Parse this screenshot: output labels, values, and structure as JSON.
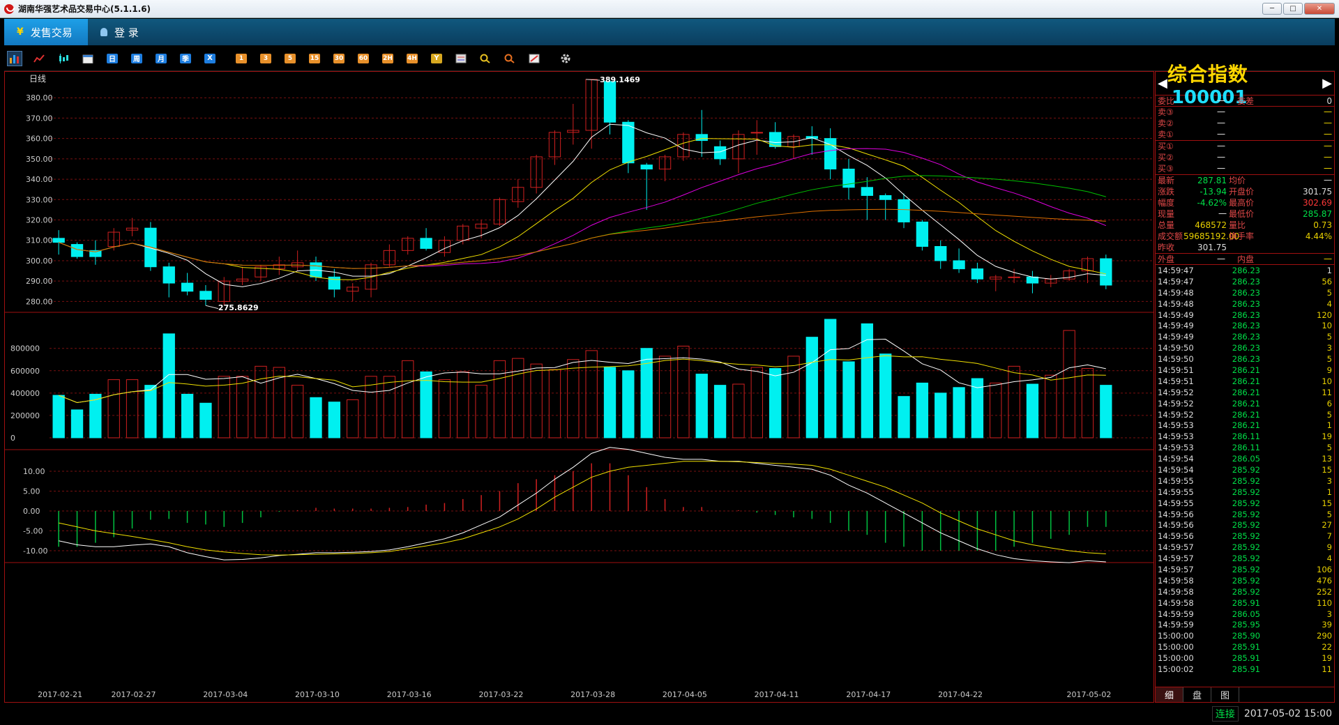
{
  "window": {
    "title": "湖南华强艺术品交易中心(5.1.1.6)",
    "controls": [
      "─",
      "□",
      "✕"
    ]
  },
  "nav": {
    "tabs": [
      {
        "label": "发售交易",
        "icon": "yen-icon",
        "active": true
      },
      {
        "label": "登 录",
        "icon": "user-icon",
        "active": false
      }
    ]
  },
  "toolbar": {
    "periods": [
      "日",
      "周",
      "月",
      "季",
      "X"
    ],
    "minutes": [
      "1",
      "3",
      "5",
      "15",
      "30",
      "60",
      "2H",
      "4H",
      "Y"
    ]
  },
  "chart": {
    "period_label": "日线",
    "price_axis": [
      "380.00",
      "370.00",
      "360.00",
      "350.00",
      "340.00",
      "330.00",
      "320.00",
      "310.00",
      "300.00",
      "290.00",
      "280.00"
    ],
    "volume_axis": [
      "800000",
      "600000",
      "400000",
      "200000",
      "0"
    ],
    "macd_axis": [
      "10.00",
      "5.00",
      "0.00",
      "-5.00",
      "-10.00"
    ],
    "high_label": "389.1469",
    "low_label": "275.8629",
    "dates": [
      "2017-02-21",
      "2017-02-27",
      "2017-03-04",
      "2017-03-10",
      "2017-03-16",
      "2017-03-22",
      "2017-03-28",
      "2017-04-05",
      "2017-04-11",
      "2017-04-17",
      "2017-04-22",
      "2017-05-02"
    ]
  },
  "chart_data": {
    "type": "candlestick",
    "candles": [
      [
        311,
        315,
        303,
        309
      ],
      [
        308,
        309,
        301,
        302
      ],
      [
        305,
        310,
        298,
        302
      ],
      [
        307,
        316,
        305,
        314
      ],
      [
        315,
        321,
        312,
        316
      ],
      [
        316,
        319,
        295,
        297
      ],
      [
        297,
        299,
        282,
        289
      ],
      [
        289,
        294,
        283,
        285
      ],
      [
        285,
        288,
        278,
        281
      ],
      [
        280,
        292,
        278,
        290
      ],
      [
        290,
        297,
        288,
        291
      ],
      [
        292,
        298,
        290,
        297
      ],
      [
        296,
        302,
        293,
        298
      ],
      [
        297,
        305,
        295,
        299
      ],
      [
        299,
        302,
        290,
        292
      ],
      [
        292,
        296,
        282,
        286
      ],
      [
        285,
        289,
        280,
        287
      ],
      [
        286,
        299,
        282,
        298
      ],
      [
        298,
        308,
        297,
        305
      ],
      [
        305,
        312,
        303,
        311
      ],
      [
        311,
        316,
        305,
        306
      ],
      [
        304,
        312,
        302,
        310
      ],
      [
        310,
        318,
        308,
        317
      ],
      [
        316,
        320,
        311,
        318
      ],
      [
        318,
        331,
        317,
        330
      ],
      [
        329,
        340,
        326,
        336
      ],
      [
        336,
        352,
        333,
        351
      ],
      [
        351,
        364,
        347,
        363
      ],
      [
        363,
        377,
        357,
        364
      ],
      [
        364,
        389,
        355,
        389
      ],
      [
        388,
        389,
        362,
        368
      ],
      [
        368,
        369,
        343,
        348
      ],
      [
        347,
        348,
        325,
        345
      ],
      [
        345,
        352,
        339,
        351
      ],
      [
        351,
        363,
        349,
        362
      ],
      [
        362,
        374,
        351,
        359
      ],
      [
        356,
        359,
        347,
        350
      ],
      [
        350,
        364,
        343,
        362
      ],
      [
        363,
        369,
        352,
        363
      ],
      [
        363,
        368,
        355,
        356
      ],
      [
        356,
        362,
        350,
        361
      ],
      [
        361,
        366,
        352,
        360
      ],
      [
        360,
        365,
        340,
        345
      ],
      [
        345,
        350,
        330,
        336
      ],
      [
        336,
        341,
        320,
        332
      ],
      [
        332,
        333,
        320,
        330
      ],
      [
        330,
        333,
        316,
        319
      ],
      [
        319,
        320,
        305,
        307
      ],
      [
        307,
        310,
        296,
        300
      ],
      [
        300,
        306,
        294,
        296
      ],
      [
        296,
        299,
        289,
        291
      ],
      [
        291,
        293,
        285,
        292
      ],
      [
        292,
        296,
        289,
        292
      ],
      [
        292,
        295,
        284,
        289
      ],
      [
        289,
        293,
        287,
        291
      ],
      [
        291,
        296,
        290,
        295
      ],
      [
        295,
        302,
        289,
        301
      ],
      [
        301,
        303,
        286,
        288
      ]
    ],
    "volume": [
      380000,
      250000,
      390000,
      520000,
      520000,
      470000,
      930000,
      390000,
      310000,
      550000,
      550000,
      640000,
      630000,
      470000,
      360000,
      320000,
      340000,
      550000,
      550000,
      690000,
      590000,
      520000,
      590000,
      470000,
      690000,
      710000,
      660000,
      610000,
      700000,
      780000,
      630000,
      600000,
      800000,
      730000,
      820000,
      570000,
      470000,
      480000,
      630000,
      620000,
      730000,
      900000,
      1060000,
      680000,
      1020000,
      750000,
      370000,
      490000,
      400000,
      450000,
      530000,
      490000,
      640000,
      480000,
      560000,
      960000,
      620000,
      470000
    ],
    "macd": {
      "dif": [
        -7.5,
        -8.5,
        -9,
        -9,
        -8.6,
        -8.3,
        -9,
        -10.5,
        -11.5,
        -12.3,
        -12.2,
        -11.8,
        -11.2,
        -10.9,
        -10.5,
        -10.5,
        -10.4,
        -10.2,
        -9.8,
        -9,
        -8,
        -7,
        -5.5,
        -3.5,
        -1.5,
        1.5,
        4.5,
        8,
        11,
        14.5,
        16,
        15.5,
        14.5,
        13.5,
        13,
        13,
        12.5,
        12.5,
        12,
        11.5,
        11,
        10.5,
        9,
        6.5,
        4.5,
        2,
        -0.5,
        -3,
        -5.5,
        -7.5,
        -9.5,
        -11,
        -12,
        -12.5,
        -12.8,
        -13,
        -12.5,
        -12.8
      ],
      "dea": [
        -3,
        -4,
        -5,
        -5.7,
        -6.4,
        -7.2,
        -8,
        -9,
        -9.8,
        -10.3,
        -10.7,
        -11,
        -11.1,
        -11,
        -10.9,
        -10.8,
        -10.7,
        -10.5,
        -10.2,
        -9.5,
        -8.8,
        -8,
        -7,
        -5.5,
        -4,
        -2,
        0.5,
        3.5,
        6,
        8.5,
        10,
        11,
        11.5,
        12,
        12.5,
        12.5,
        12.5,
        12.4,
        12.2,
        12,
        11.8,
        11.5,
        10.5,
        9,
        7.5,
        6,
        4,
        2,
        -0.5,
        -2.5,
        -4.5,
        -6,
        -7.5,
        -8.5,
        -9.3,
        -10,
        -10.5,
        -10.8
      ]
    },
    "ylim": [
      275,
      390
    ]
  },
  "quote": {
    "name": "综合指数",
    "code": "100001",
    "weibi_label": "委比",
    "weibi_val": "一",
    "weicha_label": "委差",
    "weicha_val": "0",
    "sells": [
      {
        "label": "卖③",
        "v": "一",
        "n": "一"
      },
      {
        "label": "卖②",
        "v": "一",
        "n": "一"
      },
      {
        "label": "卖①",
        "v": "一",
        "n": "一"
      }
    ],
    "buys": [
      {
        "label": "买①",
        "v": "一",
        "n": "一"
      },
      {
        "label": "买②",
        "v": "一",
        "n": "一"
      },
      {
        "label": "买③",
        "v": "一",
        "n": "一"
      }
    ],
    "stats": [
      {
        "l1": "最新",
        "v1": "287.81",
        "c1": "g",
        "l2": "均价",
        "v2": "一",
        "c2": "w"
      },
      {
        "l1": "涨跌",
        "v1": "-13.94",
        "c1": "g",
        "l2": "开盘价",
        "v2": "301.75",
        "c2": "w"
      },
      {
        "l1": "幅度",
        "v1": "-4.62%",
        "c1": "g",
        "l2": "最高价",
        "v2": "302.69",
        "c2": "r"
      },
      {
        "l1": "现量",
        "v1": "一",
        "c1": "w",
        "l2": "最低价",
        "v2": "285.87",
        "c2": "g"
      },
      {
        "l1": "总量",
        "v1": "468572",
        "c1": "y",
        "l2": "量比",
        "v2": "0.73",
        "c2": "y"
      },
      {
        "l1": "成交额",
        "v1": "59685192.00",
        "c1": "y",
        "l2": "换手率",
        "v2": "4.44%",
        "c2": "y"
      },
      {
        "l1": "昨收",
        "v1": "301.75",
        "c1": "w",
        "l2": "",
        "v2": "",
        "c2": "w"
      }
    ],
    "outer_label": "外盘",
    "outer_val": "一",
    "inner_label": "内盘",
    "inner_val": "一"
  },
  "trades": [
    [
      "14:59:47",
      "286.23",
      "1",
      "w"
    ],
    [
      "14:59:47",
      "286.23",
      "56",
      "y"
    ],
    [
      "14:59:48",
      "286.23",
      "5",
      "y"
    ],
    [
      "14:59:48",
      "286.23",
      "4",
      "y"
    ],
    [
      "14:59:49",
      "286.23",
      "120",
      "y"
    ],
    [
      "14:59:49",
      "286.23",
      "10",
      "y"
    ],
    [
      "14:59:49",
      "286.23",
      "5",
      "y"
    ],
    [
      "14:59:50",
      "286.23",
      "3",
      "y"
    ],
    [
      "14:59:50",
      "286.23",
      "5",
      "y"
    ],
    [
      "14:59:51",
      "286.21",
      "9",
      "y"
    ],
    [
      "14:59:51",
      "286.21",
      "10",
      "y"
    ],
    [
      "14:59:52",
      "286.21",
      "11",
      "y"
    ],
    [
      "14:59:52",
      "286.21",
      "6",
      "y"
    ],
    [
      "14:59:52",
      "286.21",
      "5",
      "y"
    ],
    [
      "14:59:53",
      "286.21",
      "1",
      "y"
    ],
    [
      "14:59:53",
      "286.11",
      "19",
      "y"
    ],
    [
      "14:59:53",
      "286.11",
      "5",
      "y"
    ],
    [
      "14:59:54",
      "286.05",
      "13",
      "y"
    ],
    [
      "14:59:54",
      "285.92",
      "15",
      "y"
    ],
    [
      "14:59:55",
      "285.92",
      "3",
      "y"
    ],
    [
      "14:59:55",
      "285.92",
      "1",
      "y"
    ],
    [
      "14:59:55",
      "285.92",
      "15",
      "y"
    ],
    [
      "14:59:56",
      "285.92",
      "5",
      "y"
    ],
    [
      "14:59:56",
      "285.92",
      "27",
      "y"
    ],
    [
      "14:59:56",
      "285.92",
      "7",
      "y"
    ],
    [
      "14:59:57",
      "285.92",
      "9",
      "y"
    ],
    [
      "14:59:57",
      "285.92",
      "4",
      "y"
    ],
    [
      "14:59:57",
      "285.92",
      "106",
      "y"
    ],
    [
      "14:59:58",
      "285.92",
      "476",
      "y"
    ],
    [
      "14:59:58",
      "285.92",
      "252",
      "y"
    ],
    [
      "14:59:58",
      "285.91",
      "110",
      "y"
    ],
    [
      "14:59:59",
      "286.05",
      "3",
      "y"
    ],
    [
      "14:59:59",
      "285.95",
      "39",
      "y"
    ],
    [
      "15:00:00",
      "285.90",
      "290",
      "y"
    ],
    [
      "15:00:00",
      "285.91",
      "22",
      "y"
    ],
    [
      "15:00:00",
      "285.91",
      "19",
      "y"
    ],
    [
      "15:00:02",
      "285.91",
      "11",
      "y"
    ]
  ],
  "panel_tabs": [
    "细",
    "盘",
    "图"
  ],
  "status": {
    "connection": "连接",
    "datetime": "2017-05-02 15:00"
  },
  "colors": {
    "up": "#d02020",
    "down": "#00f0f0",
    "ma5": "#ffffff",
    "ma10": "#f0e000",
    "ma20": "#e000e0",
    "ma30": "#00c000",
    "ma60": "#e07000"
  }
}
